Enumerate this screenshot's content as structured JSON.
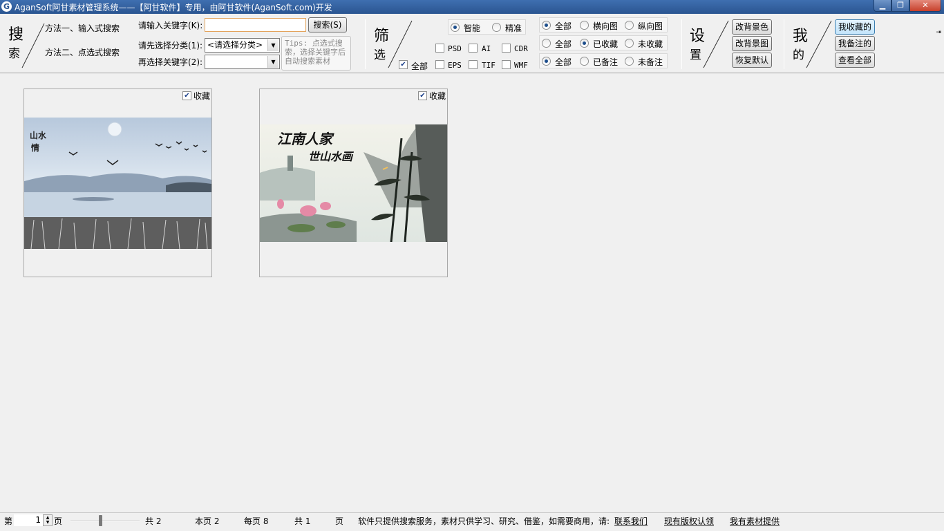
{
  "window": {
    "logo": "G",
    "title": "AganSoft阿甘素材管理系统——【阿甘软件】专用，由阿甘软件(AganSoft.com)开发",
    "min_glyph": "▁",
    "max_glyph": "❐",
    "close_glyph": "✕"
  },
  "search": {
    "label_top": "搜",
    "label_bottom": "索",
    "method1": "方法一、输入式搜索",
    "method2": "方法二、点选式搜索",
    "keyword_label": "请输入关键字(K):",
    "keyword_value": "",
    "search_button": "搜索(S)",
    "category_label": "请先选择分类(1):",
    "category_value": "<请选择分类>",
    "keyword2_label": "再选择关键字(2):",
    "keyword2_value": "",
    "tips": "Tips: 点选式搜索，选择关键字后自动搜索素材"
  },
  "filter": {
    "label_top": "筛",
    "label_bottom": "选",
    "mode_smart": "智能",
    "mode_exact": "精准",
    "mode_selected": "smart",
    "all_label": "全部",
    "all_checked": true,
    "formats": [
      "PSD",
      "AI",
      "CDR",
      "EPS",
      "TIF",
      "WMF"
    ]
  },
  "options": {
    "orientation": [
      "全部",
      "横向图",
      "纵向图"
    ],
    "orientation_selected": 0,
    "favorite": [
      "全部",
      "已收藏",
      "未收藏"
    ],
    "favorite_selected": 1,
    "note": [
      "全部",
      "已备注",
      "未备注"
    ],
    "note_selected": 0
  },
  "settings": {
    "label_top": "设",
    "label_bottom": "置",
    "bg_color": "改背景色",
    "bg_image": "改背景图",
    "restore": "恢复默认"
  },
  "mine": {
    "label_top": "我",
    "label_bottom": "的",
    "my_favorites": "我收藏的",
    "my_notes": "我备注的",
    "view_all": "查看全部"
  },
  "cards": [
    {
      "fav_label": "收藏",
      "fav_checked": true,
      "image": "landscape-cranes"
    },
    {
      "fav_label": "收藏",
      "fav_checked": true,
      "image": "ink-bamboo-lotus"
    }
  ],
  "status": {
    "page_prefix": "第",
    "page_value": "1",
    "page_suffix": "页",
    "total_pages": "共 2",
    "this_page": "本页 2",
    "per_page": "每页 8",
    "total_count": "共 1",
    "page_unit": "页",
    "notice": "软件只提供搜索服务，素材只供学习、研究、借鉴，如需要商用，请:",
    "contact": "联系我们",
    "copyright": "现有版权认领",
    "provide": "我有素材提供"
  }
}
